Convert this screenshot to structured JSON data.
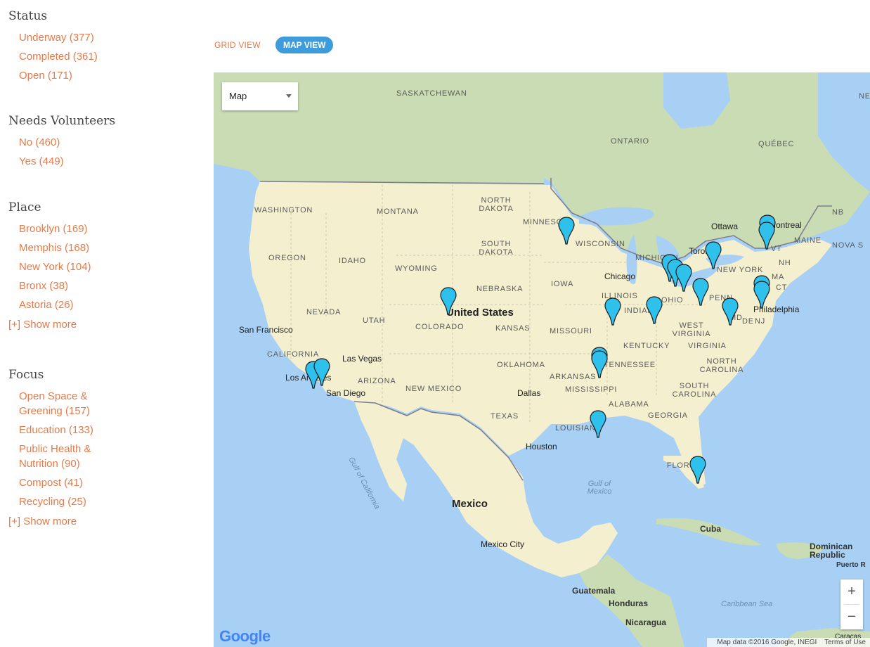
{
  "sidebar": {
    "status": {
      "title": "Status",
      "items": [
        "Underway (377)",
        "Completed (361)",
        "Open (171)"
      ]
    },
    "volunteers": {
      "title": "Needs Volunteers",
      "items": [
        "No (460)",
        "Yes (449)"
      ]
    },
    "place": {
      "title": "Place",
      "items": [
        "Brooklyn (169)",
        "Memphis (168)",
        "New York (104)",
        "Bronx (38)",
        "Astoria (26)"
      ],
      "show_more": "[+] Show more"
    },
    "focus": {
      "title": "Focus",
      "items": [
        "Open Space & Greening (157)",
        "Education (133)",
        "Public Health & Nutrition (90)",
        "Compost (41)",
        "Recycling (25)"
      ],
      "show_more": "[+] Show more"
    }
  },
  "views": {
    "grid": "GRID VIEW",
    "map": "MAP VIEW"
  },
  "map": {
    "type_select": "Map",
    "zoom_in": "+",
    "zoom_out": "−",
    "logo": "Google",
    "attribution": "Map data ©2016 Google, INEGI",
    "terms": "Terms of Use",
    "labels": {
      "saskatchewan": "SASKATCHEWAN",
      "ontario": "ONTARIO",
      "quebec": "QUÉBEC",
      "nb": "NB",
      "nova": "NOVA S",
      "newfound": "NEW AN",
      "washington": "WASHINGTON",
      "montana": "MONTANA",
      "north_dakota": "NORTH DAKOTA",
      "minnesota": "MINNESOTA",
      "south_dakota": "SOUTH DAKOTA",
      "wisconsin": "WISCONSIN",
      "michigan": "MICHIGAN",
      "oregon": "OREGON",
      "idaho": "IDAHO",
      "wyoming": "WYOMING",
      "nebraska": "NEBRASKA",
      "iowa": "IOWA",
      "illinois": "ILLINOIS",
      "indiana": "INDIANA",
      "ohio": "OHIO",
      "penn": "PENN",
      "new_york": "NEW YORK",
      "maine": "MAINE",
      "nh": "NH",
      "vt": "VT",
      "ma": "MA",
      "ct": "CT",
      "nj": "NJ",
      "de": "DE",
      "md": "MD",
      "nevada": "NEVADA",
      "utah": "UTAH",
      "colorado": "COLORADO",
      "kansas": "KANSAS",
      "missouri": "MISSOURI",
      "kentucky": "KENTUCKY",
      "west_virginia": "WEST VIRGINIA",
      "virginia": "VIRGINIA",
      "california": "CALIFORNIA",
      "arizona": "ARIZONA",
      "new_mexico": "NEW MEXICO",
      "oklahoma": "OKLAHOMA",
      "arkansas": "ARKANSAS",
      "tennessee": "TENNESSEE",
      "north_carolina": "NORTH CAROLINA",
      "south_carolina": "SOUTH CAROLINA",
      "mississippi": "MISSISSIPPI",
      "alabama": "ALABAMA",
      "georgia": "GEORGIA",
      "texas": "TEXAS",
      "louisiana": "LOUISIANA",
      "florida": "FLORIDA",
      "united_states": "United States",
      "mexico": "Mexico",
      "cuba": "Cuba",
      "dominican": "Dominican Republic",
      "puerto": "Puerto R",
      "guatemala": "Guatemala",
      "honduras": "Honduras",
      "nicaragua": "Nicaragua",
      "caracas": "Caracas",
      "san_francisco": "San Francisco",
      "las_vegas": "Las Vegas",
      "los_angeles": "Los Angeles",
      "san_diego": "San Diego",
      "dallas": "Dallas",
      "houston": "Houston",
      "chicago": "Chicago",
      "toronto": "Toronto",
      "ottawa": "Ottawa",
      "montreal": "Montreal",
      "philadelphia": "Philadelphia",
      "mexico_city": "Mexico City",
      "gulf_california": "Gulf of California",
      "gulf_mexico": "Gulf of Mexico",
      "caribbean": "Caribbean Sea"
    }
  },
  "colors": {
    "accent": "#e47b4a",
    "toggle": "#3d9cd9",
    "pin": "#2ec1ec"
  }
}
